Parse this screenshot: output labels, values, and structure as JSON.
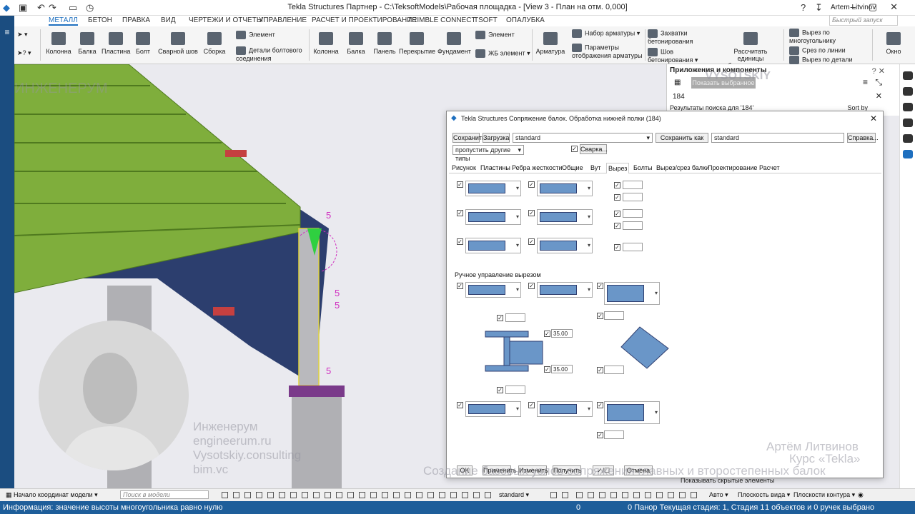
{
  "window": {
    "title": "Tekla Structures Партнер - C:\\TeksoftModels\\Рабочая площадка - [View 3 - План на отм. 0,000]",
    "user": "Artem Litvinov",
    "quick_launch_placeholder": "Быстрый запуск"
  },
  "menu": [
    "МЕТАЛЛ",
    "БЕТОН",
    "ПРАВКА",
    "ВИД",
    "ЧЕРТЕЖИ И ОТЧЕТЫ",
    "УПРАВЛЕНИЕ",
    "РАСЧЕТ И ПРОЕКТИРОВАНИЕ",
    "TRIMBLE CONNECT",
    "TSOFT",
    "ОПАЛУБКА"
  ],
  "ribbon": {
    "steel": [
      "Колонна",
      "Балка",
      "Пластина",
      "Болт",
      "Сварной шов",
      "Сборка"
    ],
    "element": "Элемент",
    "bolt_details": "Детали болтового соединения",
    "concrete": [
      "Колонна",
      "Балка",
      "Панель",
      "Перекрытие",
      "Фундамент"
    ],
    "concrete_element": "Элемент",
    "rc_element": "ЖБ элемент",
    "rebar": "Арматура",
    "rebar_set": "Набор арматуры",
    "rebar_display": "Параметры отображения арматуры",
    "pour_grips": "Захватки бетонирования",
    "pour_seam": "Шов бетонирования",
    "pour_units": "Рассчитать единицы бетонирования",
    "cut_polygon": "Вырез по многоугольнику",
    "cut_line": "Срез по линии",
    "cut_part": "Вырез по детали",
    "window": "Окно"
  },
  "panel": {
    "title": "Приложения и компоненты",
    "show_selected": "Показать выбранное",
    "search_value": "184",
    "results": "Результаты поиска для '184'",
    "sort": "Sort by"
  },
  "dialog": {
    "title": "Tekla Structures  Сопряжение балок. Обработка нижней полки (184)",
    "save": "Сохранить",
    "load": "Загрузка",
    "preset": "standard",
    "save_as": "Сохранить как",
    "save_as_value": "standard",
    "help": "Справка...",
    "skip_other": "пропустить другие типы",
    "welding": "Сварка...",
    "tabs": [
      "Рисунок",
      "Пластины",
      "Ребра жесткости",
      "Общие",
      "Вут",
      "Вырез",
      "Болты",
      "Вырез/срез балки",
      "Проектирование",
      "Расчет"
    ],
    "active_tab": "Вырез",
    "manual_label": "Ручное управление вырезом",
    "dim_top": "35.00",
    "dim_bottom": "35.00",
    "buttons": [
      "OK",
      "Применить",
      "Изменить",
      "Получить",
      "✓/☐",
      "Отмена"
    ]
  },
  "overlay": {
    "lines": [
      "Инженерум",
      "engineerum.ru",
      "Vysotskiy.consulting",
      "bim.vc"
    ],
    "author": "Артём Литвинов",
    "course": "Курс «Tekla»",
    "caption": "Создание базовых узлов сопряжения главных и второстепенных балок",
    "brand_left": "ИНЖЕНЕРУМ",
    "brand_right": "VYSOTSKIY"
  },
  "model_labels": [
    "5",
    "5",
    "5",
    "5"
  ],
  "statusbar": {
    "origin": "Начало координат модели",
    "search": "Поиск в модели",
    "preset": "standard",
    "auto": "Авто",
    "view_plane": "Плоскость вида",
    "contour_plane": "Плоскости контура",
    "hidden": "Показывать скрытые элементы"
  },
  "info": {
    "message": "Информация: значение высоты многоугольника равно нулю",
    "zero": "0",
    "stage": "0  Панор Текущая стадия: 1, Стадия 1",
    "selection": "1 объектов и 0 ручек выбрано"
  }
}
